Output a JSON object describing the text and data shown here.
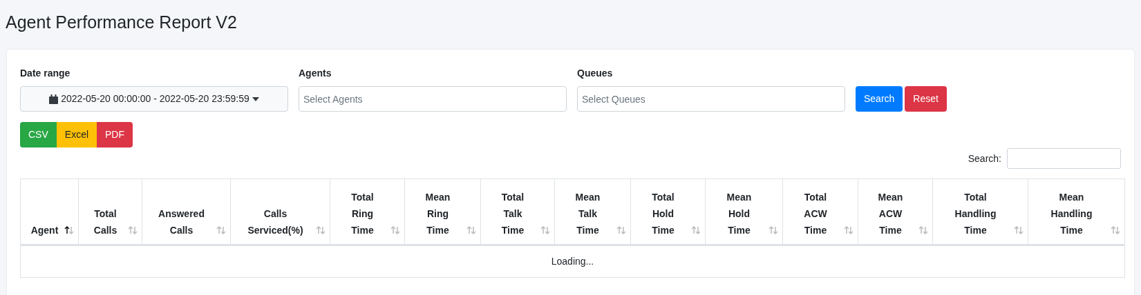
{
  "page_title": "Agent Performance Report V2",
  "filters": [
    {
      "kind": "daterange",
      "label": "Date range",
      "value": "2022-05-20 00:00:00 - 2022-05-20 23:59:59"
    },
    {
      "kind": "select",
      "label": "Agents",
      "placeholder": "Select Agents"
    },
    {
      "kind": "select",
      "label": "Queues",
      "placeholder": "Select Queues"
    }
  ],
  "actions": [
    {
      "kind": "primary",
      "label": "Search"
    },
    {
      "kind": "danger",
      "label": "Reset"
    }
  ],
  "exports": [
    {
      "label": "CSV",
      "color": "#28a745"
    },
    {
      "label": "Excel",
      "color": "#ffc107"
    },
    {
      "label": "PDF",
      "color": "#dc3545"
    }
  ],
  "table_search": {
    "label": "Search:"
  },
  "table": {
    "columns": [
      {
        "lines": [
          "Agent"
        ],
        "sorted_ascending": true
      },
      {
        "lines": [
          "Total",
          "Calls"
        ],
        "sorted_ascending": false
      },
      {
        "lines": [
          "Answered",
          "Calls"
        ],
        "sorted_ascending": false
      },
      {
        "lines": [
          "Calls",
          "Serviced(%)"
        ],
        "sorted_ascending": false
      },
      {
        "lines": [
          "Total",
          "Ring",
          "Time"
        ],
        "sorted_ascending": false
      },
      {
        "lines": [
          "Mean",
          "Ring",
          "Time"
        ],
        "sorted_ascending": false
      },
      {
        "lines": [
          "Total",
          "Talk",
          "Time"
        ],
        "sorted_ascending": false
      },
      {
        "lines": [
          "Mean",
          "Talk",
          "Time"
        ],
        "sorted_ascending": false
      },
      {
        "lines": [
          "Total",
          "Hold",
          "Time"
        ],
        "sorted_ascending": false
      },
      {
        "lines": [
          "Mean",
          "Hold",
          "Time"
        ],
        "sorted_ascending": false
      },
      {
        "lines": [
          "Total",
          "ACW",
          "Time"
        ],
        "sorted_ascending": false
      },
      {
        "lines": [
          "Mean",
          "ACW",
          "Time"
        ],
        "sorted_ascending": false
      },
      {
        "lines": [
          "Total",
          "Handling",
          "Time"
        ],
        "sorted_ascending": false
      },
      {
        "lines": [
          "Mean",
          "Handling",
          "Time"
        ],
        "sorted_ascending": false
      }
    ],
    "status": "Loading..."
  }
}
